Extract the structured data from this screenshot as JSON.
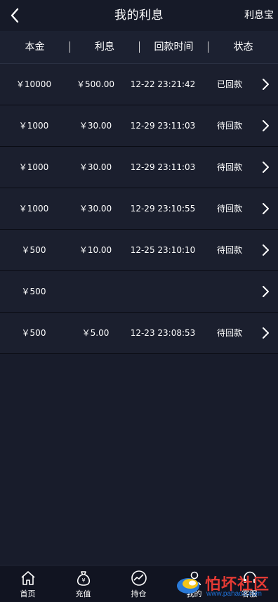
{
  "topbar": {
    "title": "我的利息",
    "right_link": "利息宝"
  },
  "table": {
    "columns": [
      "本金",
      "利息",
      "回款时间",
      "状态"
    ],
    "rows": [
      {
        "principal": "￥10000",
        "interest": "￥500.00",
        "time": "12-22 23:21:42",
        "status": "已回款"
      },
      {
        "principal": "￥1000",
        "interest": "￥30.00",
        "time": "12-29 23:11:03",
        "status": "待回款"
      },
      {
        "principal": "￥1000",
        "interest": "￥30.00",
        "time": "12-29 23:11:03",
        "status": "待回款"
      },
      {
        "principal": "￥1000",
        "interest": "￥30.00",
        "time": "12-29 23:10:55",
        "status": "待回款"
      },
      {
        "principal": "￥500",
        "interest": "￥10.00",
        "time": "12-25 23:10:10",
        "status": "待回款"
      },
      {
        "principal": "￥500",
        "interest": "",
        "time": "",
        "status": ""
      },
      {
        "principal": "￥500",
        "interest": "￥5.00",
        "time": "12-23 23:08:53",
        "status": "待回款"
      }
    ]
  },
  "tabbar": {
    "tabs": [
      {
        "label": "首页",
        "icon": "home-icon"
      },
      {
        "label": "充值",
        "icon": "money-bag-icon"
      },
      {
        "label": "持仓",
        "icon": "chart-icon"
      },
      {
        "label": "我的",
        "icon": "user-icon"
      },
      {
        "label": "客服",
        "icon": "headset-icon"
      }
    ]
  },
  "watermark": {
    "text": "怕坏社区",
    "url": "www.pahaoo.com"
  }
}
